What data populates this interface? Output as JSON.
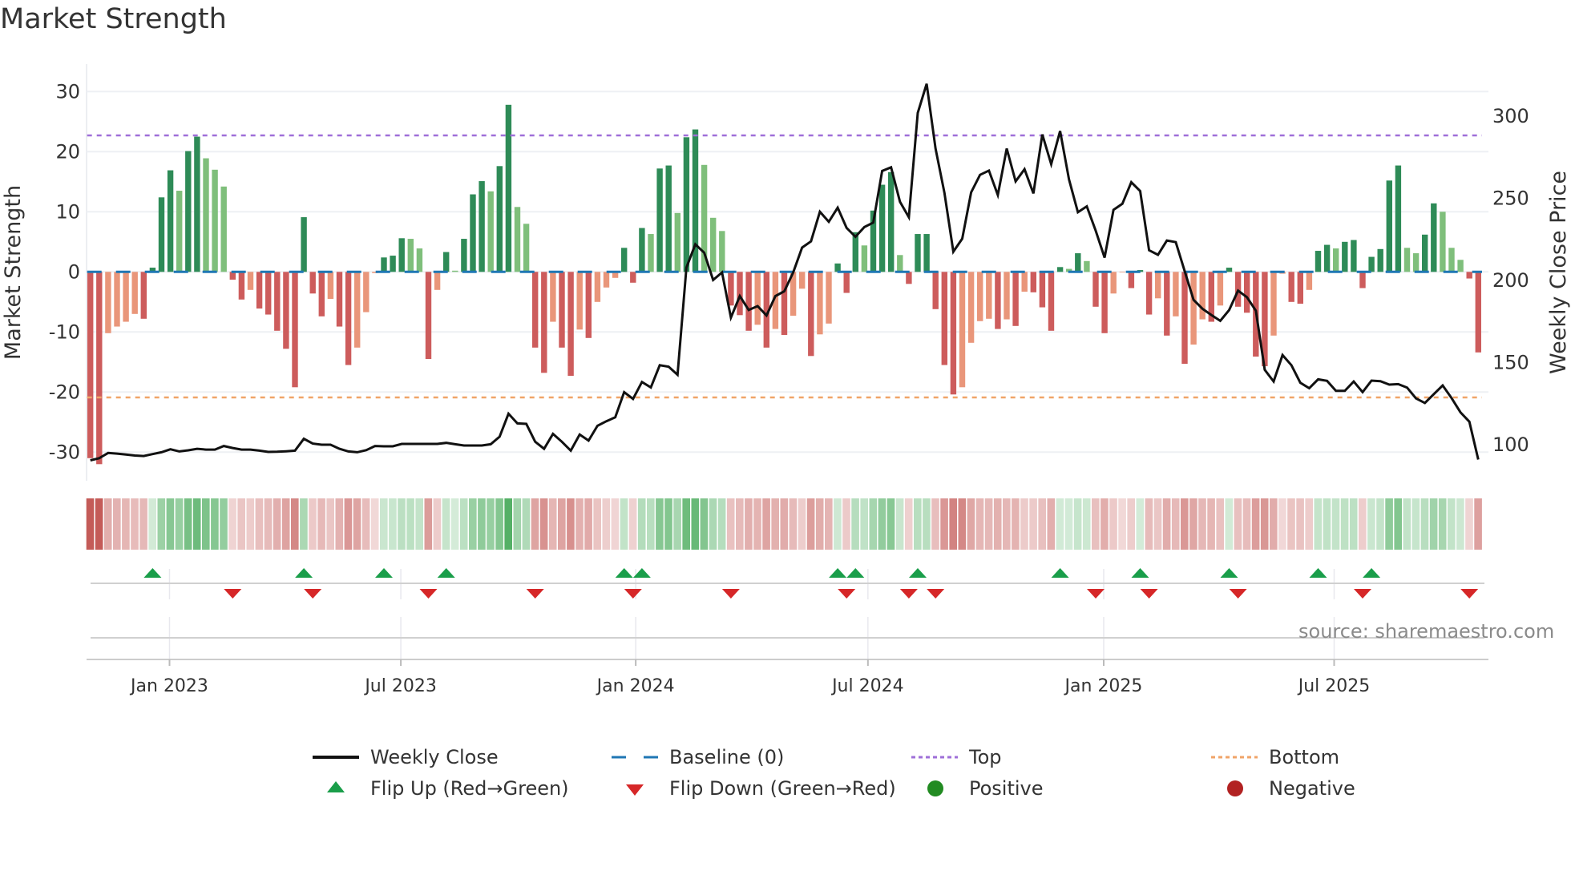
{
  "title": "Market Strength",
  "source": "source: sharemaestro.com",
  "legend": {
    "weekly_close": "Weekly Close",
    "baseline": "Baseline (0)",
    "top": "Top",
    "bottom": "Bottom",
    "flip_up": "Flip Up (Red→Green)",
    "flip_down": "Flip Down (Green→Red)",
    "positive": "Positive",
    "negative": "Negative"
  },
  "colors": {
    "strong_green": "#2e8b57",
    "weak_green": "#7fbf7b",
    "strong_red": "#cd5c5c",
    "weak_red": "#e9967a",
    "baseline": "#1f77b4",
    "top": "#9f6fd8",
    "bottom": "#f0a468",
    "close": "#111111",
    "flip_up": "#1a9e4a",
    "flip_down": "#d62728",
    "positive": "#228b22",
    "negative": "#b22222"
  },
  "chart_data": {
    "type": "bar+line",
    "title": "Market Strength",
    "ylabel": "Market Strength",
    "y2label": "Weekly Close Price",
    "ylim": [
      -35,
      34
    ],
    "y2lim": [
      80,
      330
    ],
    "yticks": [
      -30,
      -20,
      -10,
      0,
      10,
      20,
      30
    ],
    "y2ticks": [
      100,
      150,
      200,
      250,
      300
    ],
    "top_level": 22.7,
    "bottom_level": -20.9,
    "x_unit": "week index",
    "xticks": [
      {
        "label": "Jan 2023",
        "week": 9.9
      },
      {
        "label": "Jul 2023",
        "week": 35.9
      },
      {
        "label": "Jan 2024",
        "week": 62.3
      },
      {
        "label": "Jul 2024",
        "week": 88.4
      },
      {
        "label": "Jan 2025",
        "week": 114.9
      },
      {
        "label": "Jul 2025",
        "week": 140.8
      }
    ],
    "strength": [
      -31,
      -32,
      -10.2,
      -9.1,
      -8.3,
      -7,
      -7.8,
      0.7,
      12.4,
      16.9,
      13.5,
      20.1,
      22.5,
      18.9,
      17,
      14.2,
      -1.3,
      -4.6,
      -3,
      -6.1,
      -7.1,
      -9.8,
      -12.8,
      -19.2,
      9.1,
      -3.6,
      -7.4,
      -4.5,
      -9.1,
      -15.5,
      -12.6,
      -6.7,
      -0.2,
      2.4,
      2.7,
      5.6,
      5.5,
      3.9,
      -14.5,
      -3,
      3.3,
      0.2,
      5.5,
      12.9,
      15.1,
      13.4,
      17.6,
      27.8,
      10.8,
      8,
      -12.6,
      -16.8,
      -8.3,
      -12.6,
      -17.3,
      -9.6,
      -11,
      -5,
      -2.6,
      -1,
      4,
      -1.8,
      7.3,
      6.3,
      17.2,
      17.7,
      9.8,
      22.4,
      23.7,
      17.8,
      9,
      6.8,
      -5.6,
      -7.2,
      -9.8,
      -8.8,
      -12.6,
      -9.5,
      -10.5,
      -7.3,
      -2.8,
      -14,
      -10.4,
      -8.6,
      1.4,
      -3.5,
      6.6,
      4.4,
      10.2,
      14.5,
      16.6,
      2.8,
      -2,
      6.3,
      6.3,
      -6.2,
      -15.5,
      -20.4,
      -19.2,
      -11.8,
      -8.2,
      -7.8,
      -9.5,
      -7.9,
      -9,
      -3.3,
      -3.4,
      -5.9,
      -9.8,
      0.8,
      0.5,
      3.1,
      1.8,
      -5.8,
      -10.2,
      -3.6,
      -0.1,
      -2.7,
      0.3,
      -7.1,
      -4.4,
      -10.6,
      -7.4,
      -15.3,
      -12.1,
      -7.9,
      -8.3,
      -5.6,
      0.7,
      -5.8,
      -6.8,
      -14.1,
      -15.7,
      -10.6,
      -0.3,
      -5,
      -5.3,
      -3,
      3.5,
      4.5,
      3.9,
      5,
      5.3,
      -2.7,
      2.5,
      3.8,
      15.2,
      17.7,
      4,
      3.1,
      6.2,
      11.4,
      10,
      4,
      2,
      -1.1,
      -13.4
    ],
    "weekly_close": [
      90.5,
      91.8,
      95,
      94.6,
      94,
      93.4,
      93.1,
      94.3,
      95.4,
      97.2,
      95.9,
      96.6,
      97.5,
      97,
      97,
      99.2,
      98,
      97,
      97,
      96.4,
      95.6,
      95.7,
      96,
      96.4,
      103.6,
      100.7,
      100,
      100,
      97.5,
      95.9,
      95.4,
      96.7,
      99.2,
      99,
      99,
      100.5,
      100.5,
      100.5,
      100.5,
      100.5,
      101.1,
      100.3,
      99.5,
      99.5,
      99.5,
      100.3,
      104.9,
      118.9,
      113,
      112.7,
      101.8,
      97.5,
      106.6,
      101.8,
      96.4,
      106.2,
      102.5,
      111.5,
      114.3,
      116.7,
      132,
      127.9,
      138.2,
      134.9,
      148.4,
      147.5,
      142.6,
      207.9,
      222,
      216.9,
      200.3,
      204.9,
      177.4,
      190.5,
      182,
      184.4,
      178.7,
      190.5,
      193.4,
      204.9,
      220,
      223.8,
      241.8,
      235.7,
      244.3,
      232,
      226.6,
      232.5,
      235.2,
      266.7,
      268.9,
      247.9,
      238.5,
      302,
      319.7,
      280.3,
      253.3,
      217.5,
      225.4,
      253.6,
      264.3,
      266.9,
      252,
      280.3,
      260.3,
      267.7,
      253,
      288.9,
      270.8,
      291,
      261.5,
      241.5,
      245.1,
      230.3,
      213.9,
      243,
      246.7,
      259.8,
      254.4,
      218.4,
      215.6,
      224.3,
      223.3,
      205.7,
      188.2,
      182.8,
      179,
      175.4,
      182,
      193.8,
      189.8,
      181.6,
      145.6,
      138.5,
      154.6,
      148.4,
      137.7,
      134.4,
      139.8,
      138.9,
      132.8,
      132.8,
      138.5,
      132,
      139,
      138.7,
      136.6,
      136.9,
      134.8,
      128.2,
      125.4,
      130.8,
      136.1,
      128.4,
      119.7,
      114,
      91
    ],
    "flip_up_weeks": [
      8,
      25,
      34,
      41,
      61,
      63,
      85,
      87,
      94,
      110,
      119,
      129,
      139,
      145
    ],
    "flip_down_weeks": [
      17,
      26,
      39,
      51,
      62,
      73,
      86,
      93,
      96,
      114,
      120,
      130,
      144,
      156
    ]
  }
}
